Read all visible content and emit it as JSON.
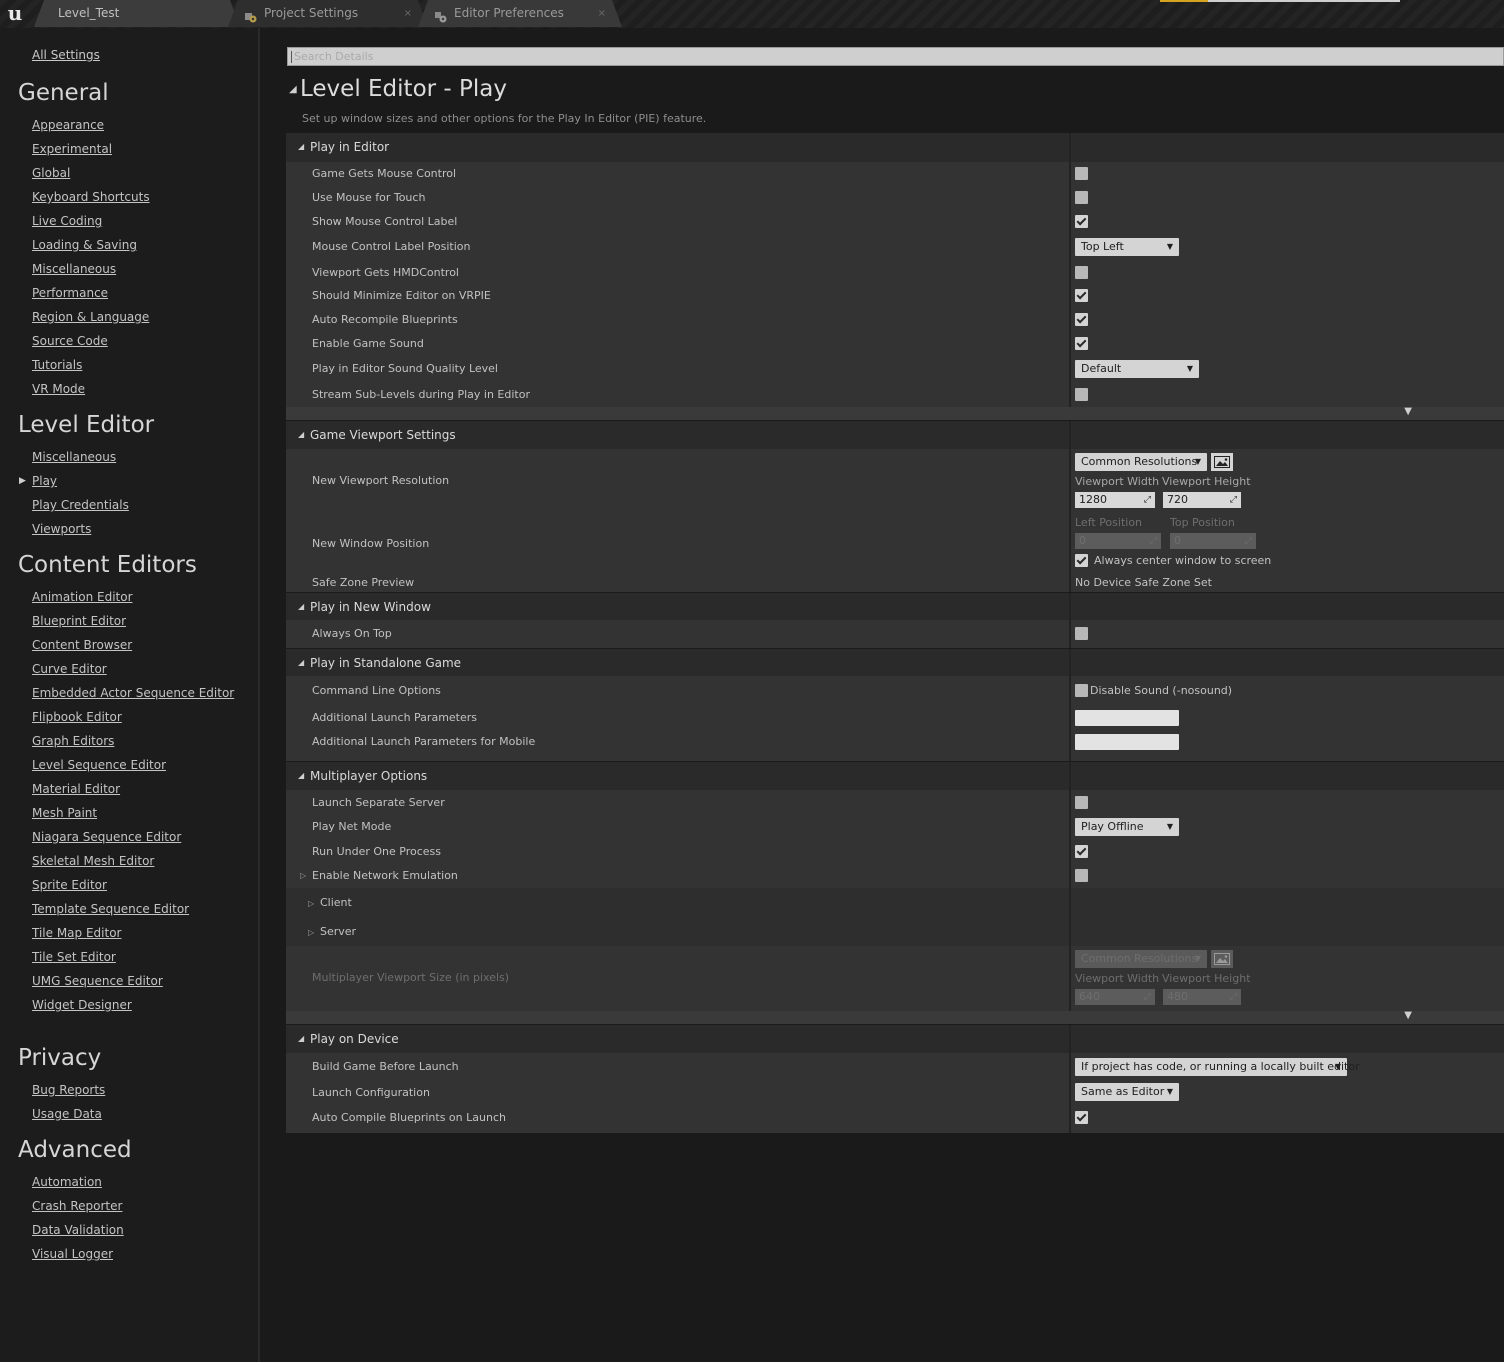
{
  "tabs": [
    {
      "label": "Level_Test",
      "close": ""
    },
    {
      "label": "Project Settings",
      "close": "×"
    },
    {
      "label": "Editor Preferences",
      "close": "×"
    }
  ],
  "logo": "u",
  "sidebar": {
    "all_settings": "All Settings",
    "sections": [
      {
        "title": "General",
        "items": [
          "Appearance",
          "Experimental",
          "Global",
          "Keyboard Shortcuts",
          "Live Coding",
          "Loading & Saving",
          "Miscellaneous",
          "Performance",
          "Region & Language",
          "Source Code",
          "Tutorials",
          "VR Mode"
        ]
      },
      {
        "title": "Level Editor",
        "items": [
          "Miscellaneous",
          "Play",
          "Play Credentials",
          "Viewports"
        ]
      },
      {
        "title": "Content Editors",
        "items": [
          "Animation Editor",
          "Blueprint Editor",
          "Content Browser",
          "Curve Editor",
          "Embedded Actor Sequence Editor",
          "Flipbook Editor",
          "Graph Editors",
          "Level Sequence Editor",
          "Material Editor",
          "Mesh Paint",
          "Niagara Sequence Editor",
          "Skeletal Mesh Editor",
          "Sprite Editor",
          "Template Sequence Editor",
          "Tile Map Editor",
          "Tile Set Editor",
          "UMG Sequence Editor",
          "Widget Designer"
        ]
      },
      {
        "title": "Privacy",
        "items": [
          "Bug Reports",
          "Usage Data"
        ]
      },
      {
        "title": "Advanced",
        "items": [
          "Automation",
          "Crash Reporter",
          "Data Validation",
          "Visual Logger"
        ]
      }
    ],
    "active_item": "Play"
  },
  "search": {
    "placeholder": "Search Details"
  },
  "page": {
    "title": "Level Editor - Play",
    "description": "Set up window sizes and other options for the Play In Editor (PIE) feature."
  },
  "play_in_editor": {
    "title": "Play in Editor",
    "rows": [
      {
        "label": "Game Gets Mouse Control",
        "checked": false
      },
      {
        "label": "Use Mouse for Touch",
        "checked": false
      },
      {
        "label": "Show Mouse Control Label",
        "checked": true
      },
      {
        "label": "Mouse Control Label Position",
        "dropdown": "Top Left"
      },
      {
        "label": "Viewport Gets HMDControl",
        "checked": false
      },
      {
        "label": "Should Minimize Editor on VRPIE",
        "checked": true
      },
      {
        "label": "Auto Recompile Blueprints",
        "checked": true
      },
      {
        "label": "Enable Game Sound",
        "checked": true
      },
      {
        "label": "Play in Editor Sound Quality Level",
        "dropdown": "Default"
      },
      {
        "label": "Stream Sub-Levels during Play in Editor",
        "checked": false
      }
    ]
  },
  "game_viewport": {
    "title": "Game Viewport Settings",
    "new_viewport_resolution": {
      "label": "New Viewport Resolution",
      "preset": "Common Resolutions",
      "width_label": "Viewport Width",
      "height_label": "Viewport Height",
      "width": "1280",
      "height": "720"
    },
    "new_window_position": {
      "label": "New Window Position",
      "left_label": "Left Position",
      "top_label": "Top Position",
      "left": "0",
      "top": "0",
      "center_label": "Always center window to screen",
      "center_checked": true
    },
    "safe_zone": {
      "label": "Safe Zone Preview",
      "value": "No Device Safe Zone Set"
    }
  },
  "play_in_new_window": {
    "title": "Play in New Window",
    "rows": [
      {
        "label": "Always On Top",
        "checked": false
      }
    ]
  },
  "standalone": {
    "title": "Play in Standalone Game",
    "command_line": {
      "label": "Command Line Options",
      "option": "Disable Sound (-nosound)",
      "checked": false
    },
    "rows": [
      {
        "label": "Additional Launch Parameters",
        "value": ""
      },
      {
        "label": "Additional Launch Parameters for Mobile",
        "value": ""
      }
    ]
  },
  "multiplayer": {
    "title": "Multiplayer Options",
    "rows": [
      {
        "label": "Launch Separate Server",
        "checked": false
      },
      {
        "label": "Play Net Mode",
        "dropdown": "Play Offline"
      },
      {
        "label": "Run Under One Process",
        "checked": true
      },
      {
        "label": "Enable Network Emulation",
        "checked": false
      }
    ],
    "client": "Client",
    "server": "Server",
    "viewport_size": {
      "label": "Multiplayer Viewport Size (in pixels)",
      "preset": "Common Resolutions",
      "width_label": "Viewport Width",
      "height_label": "Viewport Height",
      "width": "640",
      "height": "480"
    }
  },
  "play_on_device": {
    "title": "Play on Device",
    "rows": [
      {
        "label": "Build Game Before Launch",
        "dropdown": "If project has code, or running a locally built editor"
      },
      {
        "label": "Launch Configuration",
        "dropdown": "Same as Editor"
      },
      {
        "label": "Auto Compile Blueprints on Launch",
        "checked": true
      }
    ]
  },
  "colors": {
    "background": "#1a1a1a",
    "panel": "#333333",
    "category": "#2a2a2a",
    "accent": "#d4a421"
  }
}
